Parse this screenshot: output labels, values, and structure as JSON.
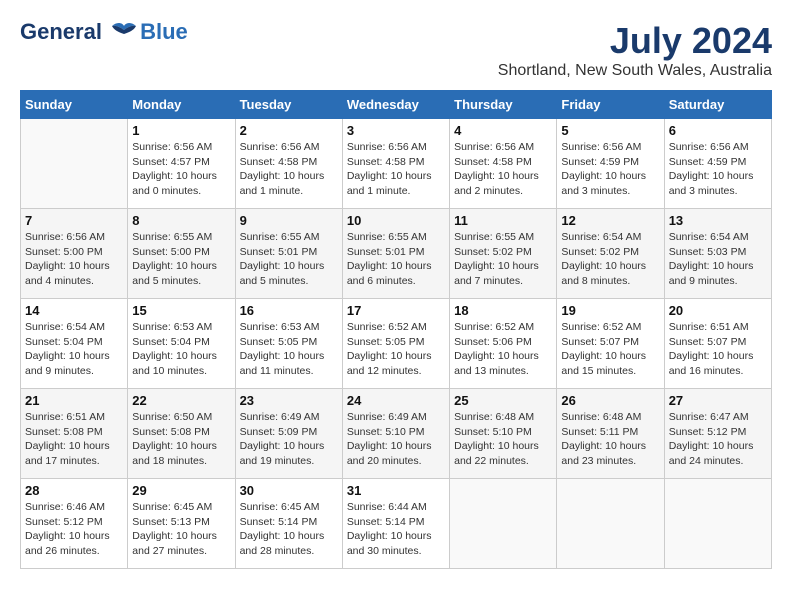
{
  "header": {
    "logo_line1": "General",
    "logo_line2": "Blue",
    "month_year": "July 2024",
    "location": "Shortland, New South Wales, Australia"
  },
  "weekdays": [
    "Sunday",
    "Monday",
    "Tuesday",
    "Wednesday",
    "Thursday",
    "Friday",
    "Saturday"
  ],
  "weeks": [
    [
      {
        "day": "",
        "info": ""
      },
      {
        "day": "1",
        "info": "Sunrise: 6:56 AM\nSunset: 4:57 PM\nDaylight: 10 hours\nand 0 minutes."
      },
      {
        "day": "2",
        "info": "Sunrise: 6:56 AM\nSunset: 4:58 PM\nDaylight: 10 hours\nand 1 minute."
      },
      {
        "day": "3",
        "info": "Sunrise: 6:56 AM\nSunset: 4:58 PM\nDaylight: 10 hours\nand 1 minute."
      },
      {
        "day": "4",
        "info": "Sunrise: 6:56 AM\nSunset: 4:58 PM\nDaylight: 10 hours\nand 2 minutes."
      },
      {
        "day": "5",
        "info": "Sunrise: 6:56 AM\nSunset: 4:59 PM\nDaylight: 10 hours\nand 3 minutes."
      },
      {
        "day": "6",
        "info": "Sunrise: 6:56 AM\nSunset: 4:59 PM\nDaylight: 10 hours\nand 3 minutes."
      }
    ],
    [
      {
        "day": "7",
        "info": "Sunrise: 6:56 AM\nSunset: 5:00 PM\nDaylight: 10 hours\nand 4 minutes."
      },
      {
        "day": "8",
        "info": "Sunrise: 6:55 AM\nSunset: 5:00 PM\nDaylight: 10 hours\nand 5 minutes."
      },
      {
        "day": "9",
        "info": "Sunrise: 6:55 AM\nSunset: 5:01 PM\nDaylight: 10 hours\nand 5 minutes."
      },
      {
        "day": "10",
        "info": "Sunrise: 6:55 AM\nSunset: 5:01 PM\nDaylight: 10 hours\nand 6 minutes."
      },
      {
        "day": "11",
        "info": "Sunrise: 6:55 AM\nSunset: 5:02 PM\nDaylight: 10 hours\nand 7 minutes."
      },
      {
        "day": "12",
        "info": "Sunrise: 6:54 AM\nSunset: 5:02 PM\nDaylight: 10 hours\nand 8 minutes."
      },
      {
        "day": "13",
        "info": "Sunrise: 6:54 AM\nSunset: 5:03 PM\nDaylight: 10 hours\nand 9 minutes."
      }
    ],
    [
      {
        "day": "14",
        "info": "Sunrise: 6:54 AM\nSunset: 5:04 PM\nDaylight: 10 hours\nand 9 minutes."
      },
      {
        "day": "15",
        "info": "Sunrise: 6:53 AM\nSunset: 5:04 PM\nDaylight: 10 hours\nand 10 minutes."
      },
      {
        "day": "16",
        "info": "Sunrise: 6:53 AM\nSunset: 5:05 PM\nDaylight: 10 hours\nand 11 minutes."
      },
      {
        "day": "17",
        "info": "Sunrise: 6:52 AM\nSunset: 5:05 PM\nDaylight: 10 hours\nand 12 minutes."
      },
      {
        "day": "18",
        "info": "Sunrise: 6:52 AM\nSunset: 5:06 PM\nDaylight: 10 hours\nand 13 minutes."
      },
      {
        "day": "19",
        "info": "Sunrise: 6:52 AM\nSunset: 5:07 PM\nDaylight: 10 hours\nand 15 minutes."
      },
      {
        "day": "20",
        "info": "Sunrise: 6:51 AM\nSunset: 5:07 PM\nDaylight: 10 hours\nand 16 minutes."
      }
    ],
    [
      {
        "day": "21",
        "info": "Sunrise: 6:51 AM\nSunset: 5:08 PM\nDaylight: 10 hours\nand 17 minutes."
      },
      {
        "day": "22",
        "info": "Sunrise: 6:50 AM\nSunset: 5:08 PM\nDaylight: 10 hours\nand 18 minutes."
      },
      {
        "day": "23",
        "info": "Sunrise: 6:49 AM\nSunset: 5:09 PM\nDaylight: 10 hours\nand 19 minutes."
      },
      {
        "day": "24",
        "info": "Sunrise: 6:49 AM\nSunset: 5:10 PM\nDaylight: 10 hours\nand 20 minutes."
      },
      {
        "day": "25",
        "info": "Sunrise: 6:48 AM\nSunset: 5:10 PM\nDaylight: 10 hours\nand 22 minutes."
      },
      {
        "day": "26",
        "info": "Sunrise: 6:48 AM\nSunset: 5:11 PM\nDaylight: 10 hours\nand 23 minutes."
      },
      {
        "day": "27",
        "info": "Sunrise: 6:47 AM\nSunset: 5:12 PM\nDaylight: 10 hours\nand 24 minutes."
      }
    ],
    [
      {
        "day": "28",
        "info": "Sunrise: 6:46 AM\nSunset: 5:12 PM\nDaylight: 10 hours\nand 26 minutes."
      },
      {
        "day": "29",
        "info": "Sunrise: 6:45 AM\nSunset: 5:13 PM\nDaylight: 10 hours\nand 27 minutes."
      },
      {
        "day": "30",
        "info": "Sunrise: 6:45 AM\nSunset: 5:14 PM\nDaylight: 10 hours\nand 28 minutes."
      },
      {
        "day": "31",
        "info": "Sunrise: 6:44 AM\nSunset: 5:14 PM\nDaylight: 10 hours\nand 30 minutes."
      },
      {
        "day": "",
        "info": ""
      },
      {
        "day": "",
        "info": ""
      },
      {
        "day": "",
        "info": ""
      }
    ]
  ]
}
